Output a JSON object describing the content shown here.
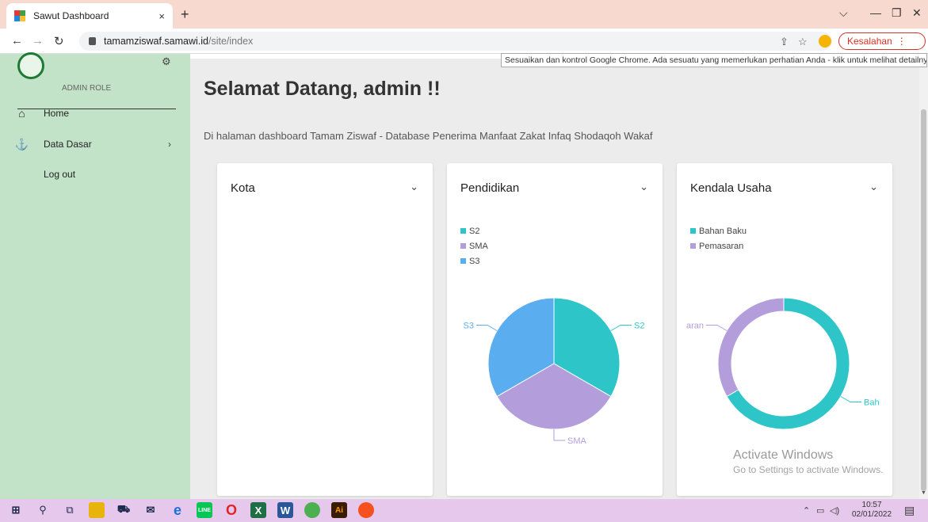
{
  "browser": {
    "tab_title": "Sawut Dashboard",
    "tab_close": "×",
    "new_tab": "+",
    "url_host": "tamamziswaf.samawi.id",
    "url_path": "/site/index",
    "error_label": "Kesalahan",
    "tooltip": "Sesuaikan dan kontrol Google Chrome. Ada sesuatu yang memerlukan perhatian Anda - klik untuk melihat detailnya."
  },
  "sidebar": {
    "role": "ADMIN ROLE",
    "items": [
      {
        "label": "Home",
        "icon": "home-icon"
      },
      {
        "label": "Data Dasar",
        "icon": "anchor-icon"
      },
      {
        "label": "Log out",
        "icon": ""
      }
    ]
  },
  "main": {
    "title": "Selamat Datang, admin !!",
    "subtitle": "Di halaman dashboard Tamam Ziswaf - Database Penerima Manfaat Zakat Infaq Shodaqoh Wakaf"
  },
  "cards": [
    {
      "title": "Kota"
    },
    {
      "title": "Pendidikan"
    },
    {
      "title": "Kendala Usaha"
    }
  ],
  "chart_data": [
    {
      "type": "pie",
      "title": "Pendidikan",
      "categories": [
        "S2",
        "SMA",
        "S3"
      ],
      "values": [
        1,
        1,
        1
      ],
      "colors": [
        "#2ec5c9",
        "#b39ddb",
        "#5aaeef"
      ],
      "outside_labels": [
        "S2",
        "SMA",
        "S3"
      ],
      "legend": "top-left"
    },
    {
      "type": "pie",
      "title": "Kendala Usaha",
      "donut": true,
      "categories": [
        "Bahan Baku",
        "Pemasaran"
      ],
      "values": [
        2,
        1
      ],
      "colors": [
        "#2ec5c9",
        "#b39ddb"
      ],
      "outside_labels": [
        "Bah",
        "aran"
      ],
      "legend": "top-left"
    }
  ],
  "watermark": {
    "line1": "Activate Windows",
    "line2": "Go to Settings to activate Windows."
  },
  "taskbar": {
    "time": "10:57",
    "date": "02/01/2022"
  }
}
